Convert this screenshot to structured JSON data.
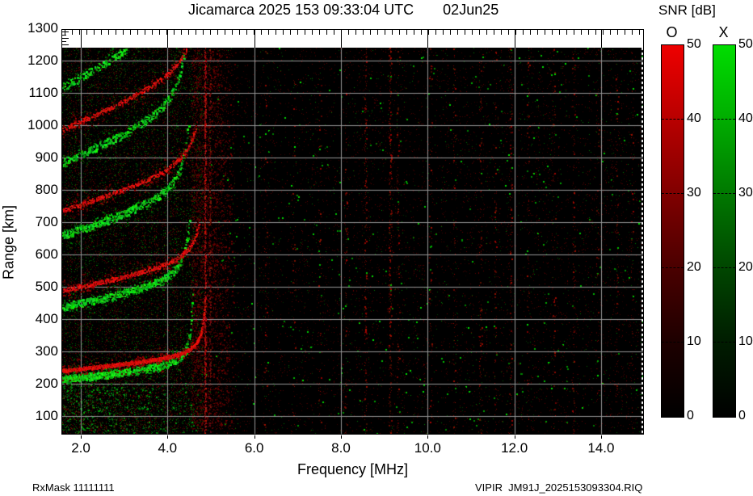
{
  "title": {
    "left": "Jicamarca 2025 153 09:33:04 UTC",
    "right": "02Jun25"
  },
  "footer": {
    "left": "RxMask 11111111",
    "right": "VIPIR  JM91J_2025153093304.RIQ"
  },
  "axes": {
    "x_label": "Frequency [MHz]",
    "y_label": "Range [km]",
    "x_tick_labels": [
      "2.0",
      "4.0",
      "6.0",
      "8.0",
      "10.0",
      "12.0",
      "14.0"
    ],
    "x_tick_values": [
      2,
      4,
      6,
      8,
      10,
      12,
      14
    ],
    "y_tick_labels": [
      "100",
      "200",
      "300",
      "400",
      "500",
      "600",
      "700",
      "800",
      "900",
      "1000",
      "1100",
      "1200",
      "1300"
    ],
    "y_tick_values": [
      100,
      200,
      300,
      400,
      500,
      600,
      700,
      800,
      900,
      1000,
      1100,
      1200,
      1300
    ]
  },
  "colorbar": {
    "title": "SNR [dB]",
    "tick_values": [
      0,
      10,
      20,
      30,
      40,
      50
    ],
    "tick_labels": [
      "0",
      "10",
      "20",
      "30",
      "40",
      "50"
    ],
    "dash_values": [
      10,
      20,
      30,
      40
    ],
    "bars": [
      {
        "label": "O",
        "top_color": "#ee0000",
        "gradient": [
          "#ee0000",
          "#b80000",
          "#800000",
          "#4a0000",
          "#1d0000",
          "#000000"
        ]
      },
      {
        "label": "X",
        "top_color": "#00dd00",
        "gradient": [
          "#00dd00",
          "#00ad00",
          "#007800",
          "#004600",
          "#001c00",
          "#000000"
        ]
      }
    ]
  },
  "chart_data": {
    "type": "heatmap",
    "title": "Jicamarca 2025 153 09:33:04 UTC 02Jun25",
    "xlabel": "Frequency [MHz]",
    "ylabel": "Range [km]",
    "zlabel": "SNR [dB]",
    "x_range_mhz": [
      1.571,
      14.97
    ],
    "y_range_km": [
      45,
      1240
    ],
    "x_gridlines_mhz": [
      2,
      4,
      6,
      8,
      10,
      12,
      14
    ],
    "y_gridlines_km": [
      100,
      200,
      300,
      400,
      500,
      600,
      700,
      800,
      900,
      1000,
      1100,
      1200
    ],
    "snr_scale_db": [
      0,
      50
    ],
    "modes": [
      {
        "name": "O",
        "color": "#ee0000"
      },
      {
        "name": "X",
        "color": "#00dd00"
      }
    ],
    "echo_traces": {
      "x_mode": {
        "color": "#00dd00",
        "base_virtual_range_km": 215,
        "critical_freq_mhz": 4.62,
        "slope_km_per_mhz": 13,
        "asym_coeff_km": 4,
        "hop_multipliers": [
          1,
          2.03,
          3.06,
          4.1,
          5.18
        ],
        "hop_max_range_km": [
          505,
          730,
          1015,
          1238,
          1238
        ],
        "hop_intensity": [
          1.0,
          0.85,
          0.75,
          0.62,
          0.5
        ]
      },
      "o_mode": {
        "color": "#ee0000",
        "base_virtual_range_km": 240,
        "critical_freq_mhz": 4.93,
        "slope_km_per_mhz": 13,
        "asym_coeff_km": 4,
        "hop_multipliers": [
          1,
          2.03,
          3.06,
          4.1,
          5.18
        ],
        "hop_max_range_km": [
          470,
          705,
          1000,
          1238,
          1238
        ],
        "hop_intensity": [
          1.0,
          0.8,
          0.7,
          0.6,
          0.5
        ]
      }
    },
    "spread_echo_region": {
      "f_mhz": [
        1.571,
        4.7
      ],
      "range_km": [
        48,
        205
      ],
      "green_density": 0.11,
      "red_density": 0.07
    },
    "diffuse_red_band": {
      "f_mhz": [
        4.55,
        5.6
      ],
      "range_km": [
        60,
        1235
      ],
      "density": 0.17
    },
    "rfi_lines": [
      {
        "f_mhz": 4.87,
        "density": 0.8,
        "min_bright": 120,
        "max_bright": 210
      },
      {
        "f_mhz": 4.98,
        "density": 0.32,
        "min_bright": 80,
        "max_bright": 145
      }
    ],
    "noise_stripes": [
      {
        "f_mhz": 6.25,
        "density": 0.1
      },
      {
        "f_mhz": 6.9,
        "density": 0.1
      },
      {
        "f_mhz": 7.5,
        "density": 0.08
      },
      {
        "f_mhz": 8.1,
        "density": 0.12
      },
      {
        "f_mhz": 8.55,
        "density": 0.33
      },
      {
        "f_mhz": 9.12,
        "density": 0.5
      },
      {
        "f_mhz": 9.3,
        "density": 0.15
      },
      {
        "f_mhz": 10.05,
        "density": 0.12
      },
      {
        "f_mhz": 10.6,
        "density": 0.15
      },
      {
        "f_mhz": 11.2,
        "density": 0.18
      },
      {
        "f_mhz": 11.55,
        "density": 0.15
      },
      {
        "f_mhz": 11.9,
        "density": 0.22
      },
      {
        "f_mhz": 12.3,
        "density": 0.12
      },
      {
        "f_mhz": 12.9,
        "density": 0.12
      },
      {
        "f_mhz": 13.35,
        "density": 0.15
      },
      {
        "f_mhz": 13.9,
        "density": 0.1
      },
      {
        "f_mhz": 14.35,
        "density": 0.15
      },
      {
        "f_mhz": 14.7,
        "density": 0.12
      }
    ],
    "background_noise": {
      "left_region_max_mhz": 4.85,
      "left_red_density": 0.09,
      "left_green_density": 0.05,
      "right_red_density": 0.024,
      "right_green_density": 0.0045,
      "seed": 1234
    }
  }
}
